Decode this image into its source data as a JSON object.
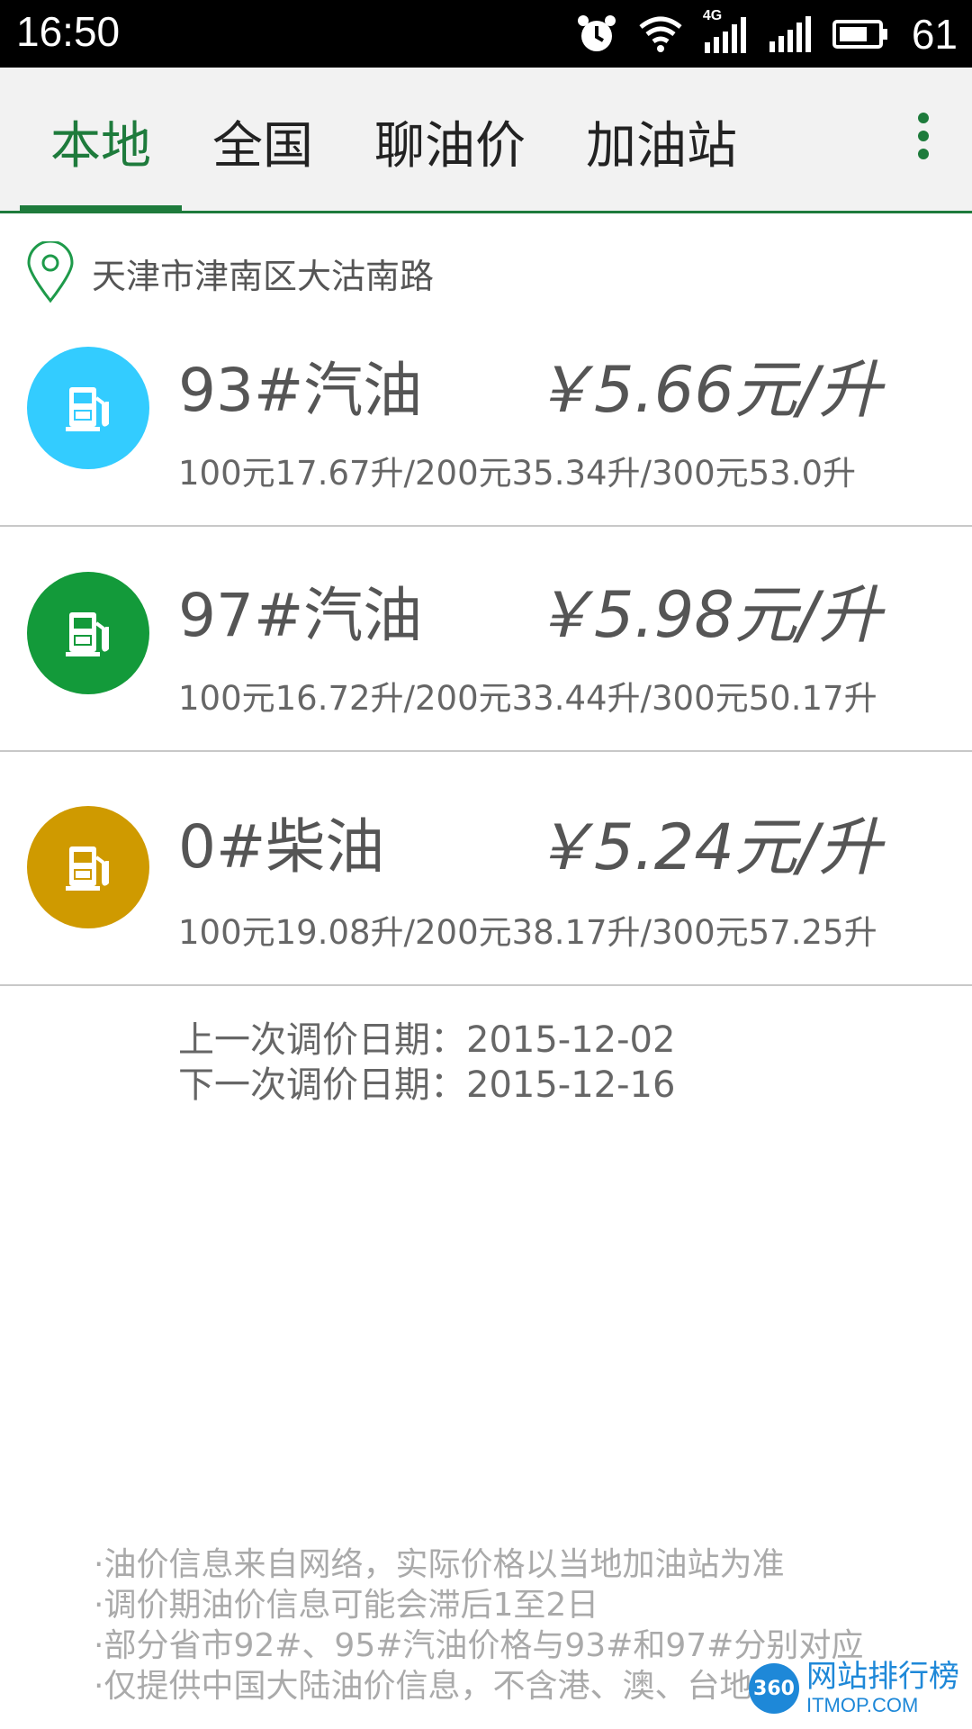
{
  "status_bar": {
    "time": "16:50",
    "network_type": "4G",
    "battery": "61",
    "icons": [
      "alarm-icon",
      "wifi-icon",
      "cellular-4g-icon",
      "cellular-icon",
      "battery-icon"
    ]
  },
  "tabs": [
    {
      "label": "本地",
      "active": true
    },
    {
      "label": "全国",
      "active": false
    },
    {
      "label": "聊油价",
      "active": false
    },
    {
      "label": "加油站",
      "active": false
    }
  ],
  "menu": {
    "icon": "more-vert-icon"
  },
  "location": {
    "icon": "map-pin-icon",
    "text": "天津市津南区大沽南路"
  },
  "fuels": [
    {
      "name": "93#汽油",
      "price": "￥5.66元/升",
      "detail": "100元17.67升/200元35.34升/300元53.0升",
      "color": "#33ccff",
      "icon": "gas-pump-icon"
    },
    {
      "name": "97#汽油",
      "price": "￥5.98元/升",
      "detail": "100元16.72升/200元33.44升/300元50.17升",
      "color": "#139a3a",
      "icon": "gas-pump-icon"
    },
    {
      "name": "0#柴油",
      "price": "￥5.24元/升",
      "detail": "100元19.08升/200元38.17升/300元57.25升",
      "color": "#cf9a00",
      "icon": "gas-pump-icon"
    }
  ],
  "dates": {
    "last": "上一次调价日期：2015-12-02",
    "next": "下一次调价日期：2015-12-16"
  },
  "notes": [
    "油价信息来自网络，实际价格以当地加油站为准",
    "调价期油价信息可能会滞后1至2日",
    "部分省市92#、95#汽油价格与93#和97#分别对应",
    "仅提供中国大陆油价信息，不含港、澳、台地区"
  ],
  "watermark": {
    "logo": "360",
    "text_cn": "网站排行榜",
    "text_en": "ITMOP.COM"
  }
}
